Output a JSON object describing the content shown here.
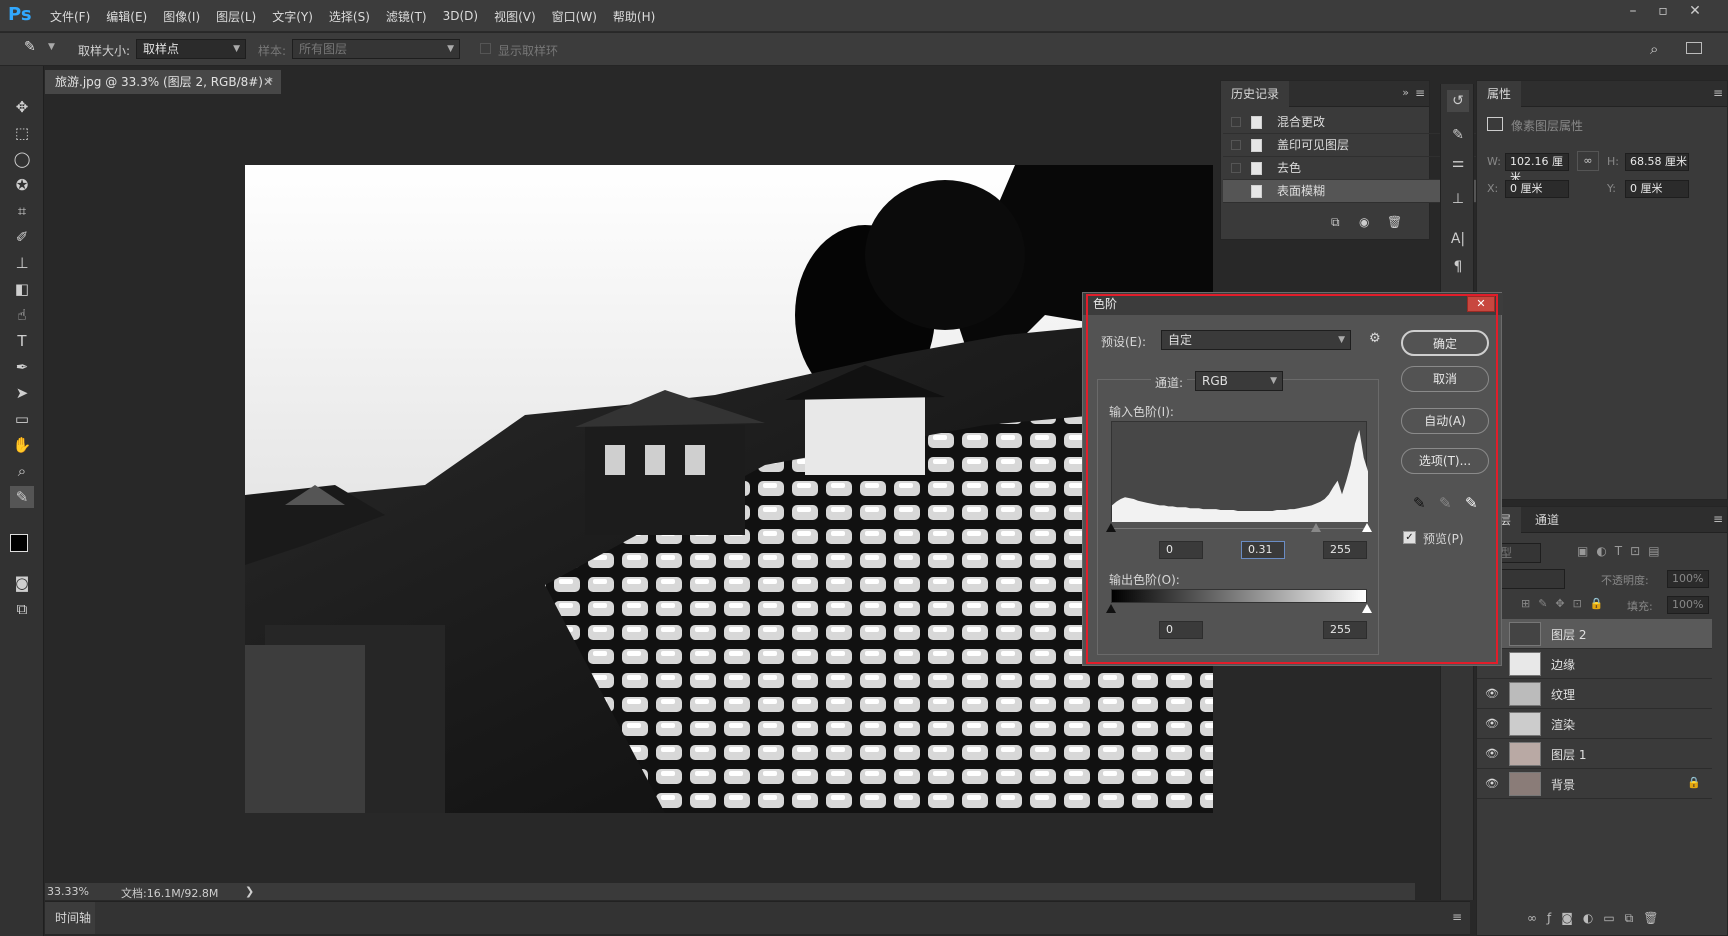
{
  "app": {
    "logo": "Ps",
    "menu": [
      "文件(F)",
      "编辑(E)",
      "图像(I)",
      "图层(L)",
      "文字(Y)",
      "选择(S)",
      "滤镜(T)",
      "3D(D)",
      "视图(V)",
      "窗口(W)",
      "帮助(H)"
    ]
  },
  "options": {
    "sample_size_label": "取样大小:",
    "sample_size_value": "取样点",
    "sample_label": "样本:",
    "sample_value": "所有图层",
    "show_ring_label": "显示取样环"
  },
  "document": {
    "tab_title": "旅游.jpg @ 33.3% (图层 2, RGB/8#) *",
    "zoom": "33.33%",
    "doc_info": "文档:16.1M/92.8M",
    "status_arrow": "❯"
  },
  "timeline": {
    "label": "时间轴"
  },
  "history": {
    "tab": "历史记录",
    "items": [
      "混合更改",
      "盖印可见图层",
      "去色",
      "表面模糊"
    ]
  },
  "properties": {
    "tab": "属性",
    "title": "像素图层属性",
    "w_label": "W:",
    "w_value": "102.16 厘米",
    "h_label": "H:",
    "h_value": "68.58 厘米",
    "x_label": "X:",
    "x_value": "0 厘米",
    "y_label": "Y:",
    "y_value": "0 厘米"
  },
  "layers": {
    "tabs": [
      "图层",
      "通道"
    ],
    "kind": "类型",
    "opacity_label": "不透明度:",
    "opacity_value": "100%",
    "fill_label": "填充:",
    "fill_value": "100%",
    "items": [
      "图层 2",
      "边缘",
      "纹理",
      "渲染",
      "图层 1",
      "背景"
    ]
  },
  "levels": {
    "title": "色阶",
    "preset_label": "预设(E):",
    "preset_value": "自定",
    "channel_label": "通道:",
    "channel_value": "RGB",
    "input_label": "输入色阶(I):",
    "input_black": "0",
    "input_gamma": "0.31",
    "input_white": "255",
    "output_label": "输出色阶(O):",
    "output_black": "0",
    "output_white": "255",
    "ok": "确定",
    "cancel": "取消",
    "auto": "自动(A)",
    "options": "选项(T)...",
    "preview": "预览(P)",
    "preview_checked": true,
    "histogram": [
      0.18,
      0.22,
      0.25,
      0.27,
      0.26,
      0.25,
      0.23,
      0.22,
      0.21,
      0.2,
      0.19,
      0.18,
      0.18,
      0.17,
      0.17,
      0.16,
      0.16,
      0.16,
      0.15,
      0.15,
      0.15,
      0.14,
      0.14,
      0.14,
      0.14,
      0.13,
      0.13,
      0.13,
      0.13,
      0.12,
      0.12,
      0.12,
      0.12,
      0.12,
      0.12,
      0.12,
      0.12,
      0.12,
      0.13,
      0.13,
      0.13,
      0.14,
      0.14,
      0.15,
      0.16,
      0.17,
      0.18,
      0.2,
      0.22,
      0.25,
      0.3,
      0.38,
      0.45,
      0.3,
      0.45,
      0.62,
      0.85,
      1.0,
      0.7,
      0.55
    ]
  }
}
